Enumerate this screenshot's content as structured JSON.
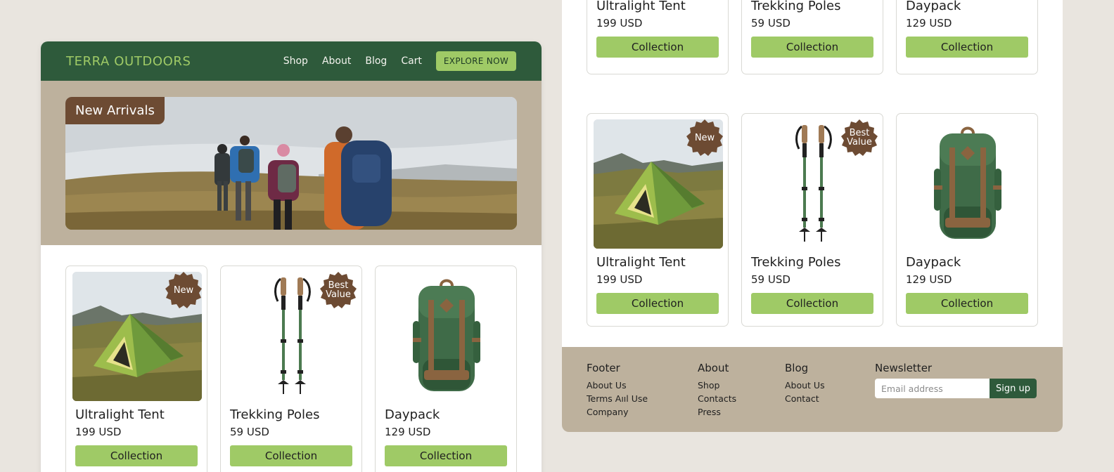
{
  "brand": "TERRA OUTDOORS",
  "nav": {
    "links": [
      "Shop",
      "About",
      "Blog",
      "Cart"
    ],
    "cta": "EXPLORE NOW"
  },
  "hero": {
    "tag": "New Arrivals"
  },
  "colors": {
    "nav_green": "#2e5a3b",
    "accent_lime": "#9fca66",
    "badge_brown": "#6d4b33",
    "band_tan": "#bdb19d"
  },
  "products": [
    {
      "name": "Ultralight Tent",
      "price": "199 USD",
      "button": "Collection",
      "badge": "New",
      "image": "tent-photo"
    },
    {
      "name": "Trekking Poles",
      "price": "59 USD",
      "button": "Collection",
      "badge_line1": "Best",
      "badge_line2": "Value",
      "image": "trekking-poles"
    },
    {
      "name": "Daypack",
      "price": "129 USD",
      "button": "Collection",
      "image": "backpack"
    }
  ],
  "footer": {
    "col1": {
      "title": "Footer",
      "links": [
        "About Us",
        "Terms Aııl Use",
        "Company"
      ]
    },
    "col2": {
      "title": "About",
      "links": [
        "Shop",
        "Contacts",
        "Press"
      ]
    },
    "col3": {
      "title": "Blog",
      "links": [
        "About Us",
        "Contact"
      ]
    },
    "newsletter": {
      "title": "Newsletter",
      "placeholder": "Email address",
      "button": "Sign up"
    }
  }
}
